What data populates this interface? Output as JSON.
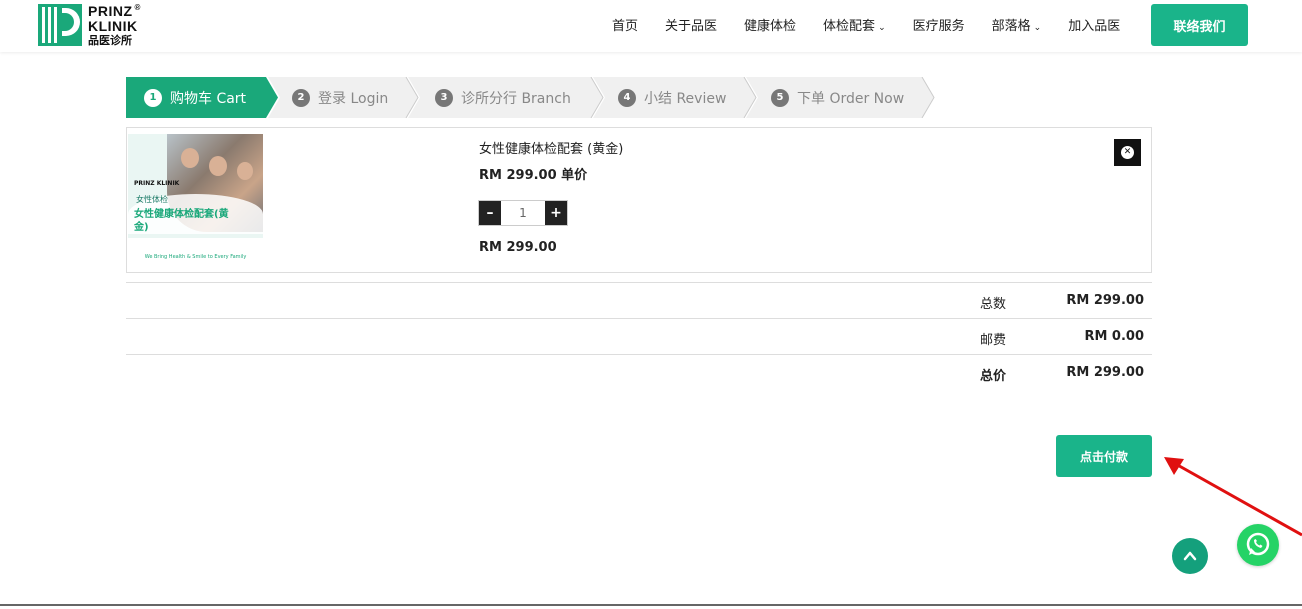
{
  "brand": {
    "line1": "PRINZ",
    "reg": "®",
    "line2": "KLINIK",
    "line3": "品医诊所"
  },
  "nav": {
    "items": [
      {
        "label": "首页",
        "dropdown": false
      },
      {
        "label": "关于品医",
        "dropdown": false
      },
      {
        "label": "健康体检",
        "dropdown": false
      },
      {
        "label": "体检配套",
        "dropdown": true
      },
      {
        "label": "医疗服务",
        "dropdown": false
      },
      {
        "label": "部落格",
        "dropdown": true
      },
      {
        "label": "加入品医",
        "dropdown": false
      }
    ],
    "contact_label": "联络我们"
  },
  "steps": [
    {
      "num": "1",
      "label": "购物车 Cart",
      "active": true
    },
    {
      "num": "2",
      "label": "登录 Login",
      "active": false
    },
    {
      "num": "3",
      "label": "诊所分行 Branch",
      "active": false
    },
    {
      "num": "4",
      "label": "小结 Review",
      "active": false
    },
    {
      "num": "5",
      "label": "下单 Order Now",
      "active": false
    }
  ],
  "cart_item": {
    "name": "女性健康体检配套 (黄金)",
    "unit_price": "RM 299.00 单价",
    "quantity": "1",
    "line_total": "RM 299.00",
    "image": {
      "brand": "PRINZ KLINIK",
      "subtitle": "女性体检",
      "title": "女性健康体检配套(黄金)",
      "tagline": "We Bring Health & Smile to Every Family"
    }
  },
  "totals": {
    "subtotal_label": "总数",
    "subtotal_value": "RM 299.00",
    "shipping_label": "邮费",
    "shipping_value": "RM 0.00",
    "grand_label": "总价",
    "grand_value": "RM 299.00"
  },
  "pay_button_label": "点击付款",
  "colors": {
    "accent": "#1ab48a",
    "annotation_arrow": "#e01010"
  }
}
